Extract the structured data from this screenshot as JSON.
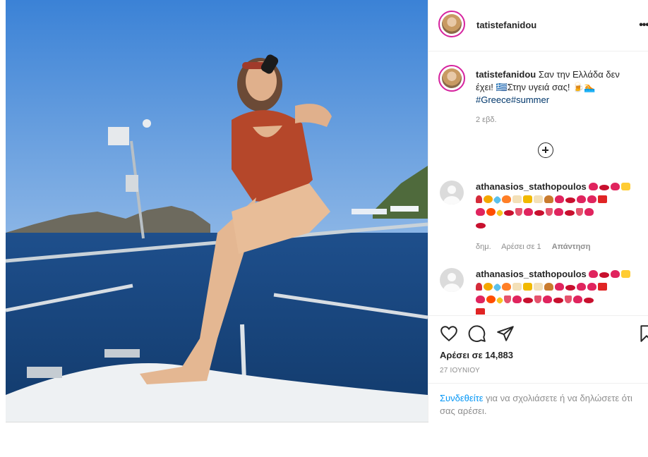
{
  "post": {
    "username": "tatistefanidou",
    "more_label": "•••",
    "caption_text": "Σαν την Ελλάδα δεν έχει! 🇬🇷Στην υγειά σας! 🍺🏊",
    "hashtags": [
      "#Greece",
      "#summer"
    ],
    "caption_time": "2 εβδ.",
    "likes_label": "Αρέσει σε 14,883",
    "date_label": "27 ΙΟΥΝΙΟΥ",
    "login_link": "Συνδεθείτε",
    "login_rest": " για να σχολιάσετε ή να δηλώσετε ότι σας αρέσει."
  },
  "comments": [
    {
      "username": "athanasios_stathopoulos",
      "time": "δημ.",
      "likes": "Αρέσει σε 1",
      "reply": "Απάντηση"
    },
    {
      "username": "athanasios_stathopoulos"
    }
  ],
  "icons": {
    "like": "heart-outline-icon",
    "comment": "comment-bubble-icon",
    "share": "paper-plane-icon",
    "save": "bookmark-icon",
    "load_more": "plus-circle-icon"
  },
  "colors": {
    "link": "#0095f6",
    "hashtag": "#00376b",
    "muted": "#8e8e8e",
    "story_ring": "#d6249f"
  }
}
